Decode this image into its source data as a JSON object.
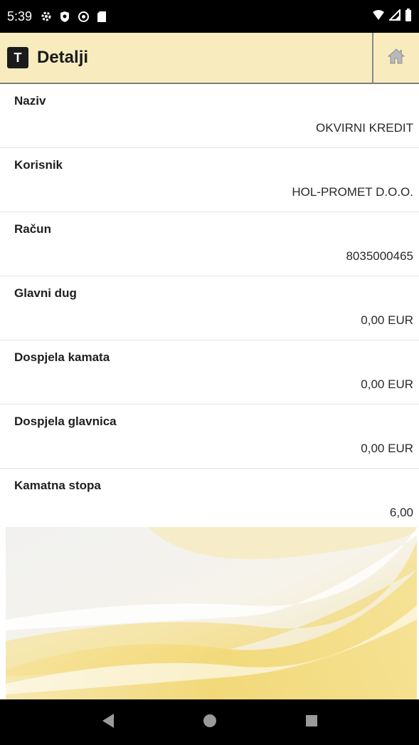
{
  "status_bar": {
    "time": "5:39",
    "icons_left": [
      "settings-icon",
      "shield-icon",
      "sync-icon",
      "sd-card-icon"
    ],
    "icons_right": [
      "wifi-icon",
      "signal-icon",
      "battery-icon"
    ]
  },
  "app_bar": {
    "logo_letter": "T",
    "title": "Detalji",
    "home_icon": "home-icon"
  },
  "details": [
    {
      "label": "Naziv",
      "value": "OKVIRNI KREDIT"
    },
    {
      "label": "Korisnik",
      "value": "HOL-PROMET D.O.O."
    },
    {
      "label": "Račun",
      "value": "8035000465"
    },
    {
      "label": "Glavni dug",
      "value": "0,00 EUR"
    },
    {
      "label": "Dospjela kamata",
      "value": "0,00 EUR"
    },
    {
      "label": "Dospjela glavnica",
      "value": "0,00 EUR"
    },
    {
      "label": "Kamatna stopa",
      "value": "6,00"
    }
  ],
  "nav_bar": {
    "buttons": [
      "back-icon",
      "home-circle-icon",
      "recents-icon"
    ]
  },
  "colors": {
    "app_bar_bg": "#f8ecbf",
    "wave_gold": "#f1d56a"
  }
}
